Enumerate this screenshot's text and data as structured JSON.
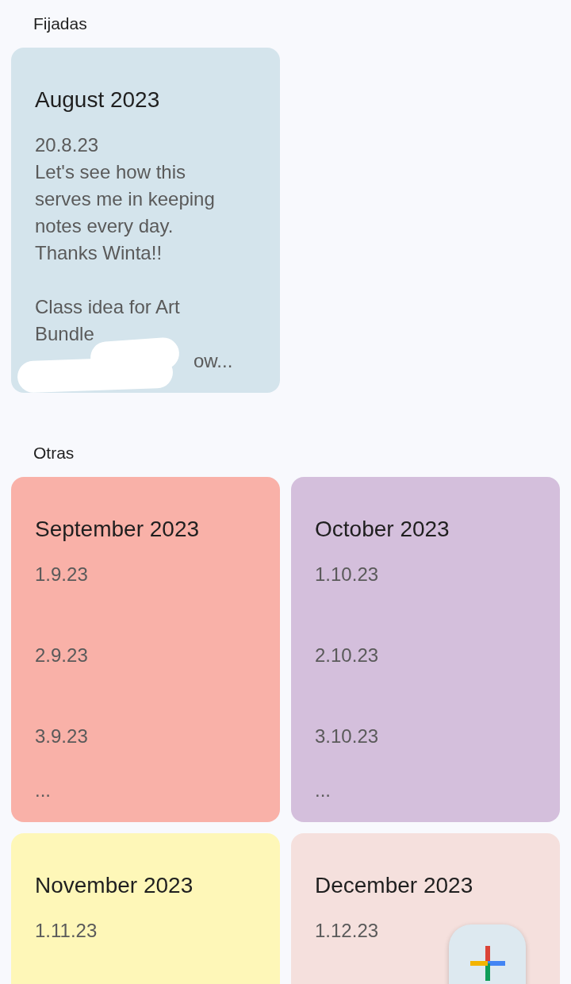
{
  "sections": [
    {
      "heading": "Fijadas",
      "notes": [
        {
          "title": "August 2023",
          "color": "#d4e4ec",
          "body": "20.8.23\nLet's see how this\nserves me in keeping\nnotes every day.\nThanks Winta!!\n\nClass idea for Art\nBundle",
          "tail": "ow..."
        }
      ]
    },
    {
      "heading": "Otras",
      "notes": [
        {
          "title": "September 2023",
          "color": "#f9b1a8",
          "body": "1.9.23\n\n\n2.9.23\n\n\n3.9.23\n\n..."
        },
        {
          "title": "October 2023",
          "color": "#d4bfdc",
          "body": "1.10.23\n\n\n2.10.23\n\n\n3.10.23\n\n..."
        },
        {
          "title": "November 2023",
          "color": "#fef7b8",
          "body": "1.11.23"
        },
        {
          "title": "December 2023",
          "color": "#f5e0dd",
          "body": "1.12.23"
        }
      ]
    }
  ]
}
